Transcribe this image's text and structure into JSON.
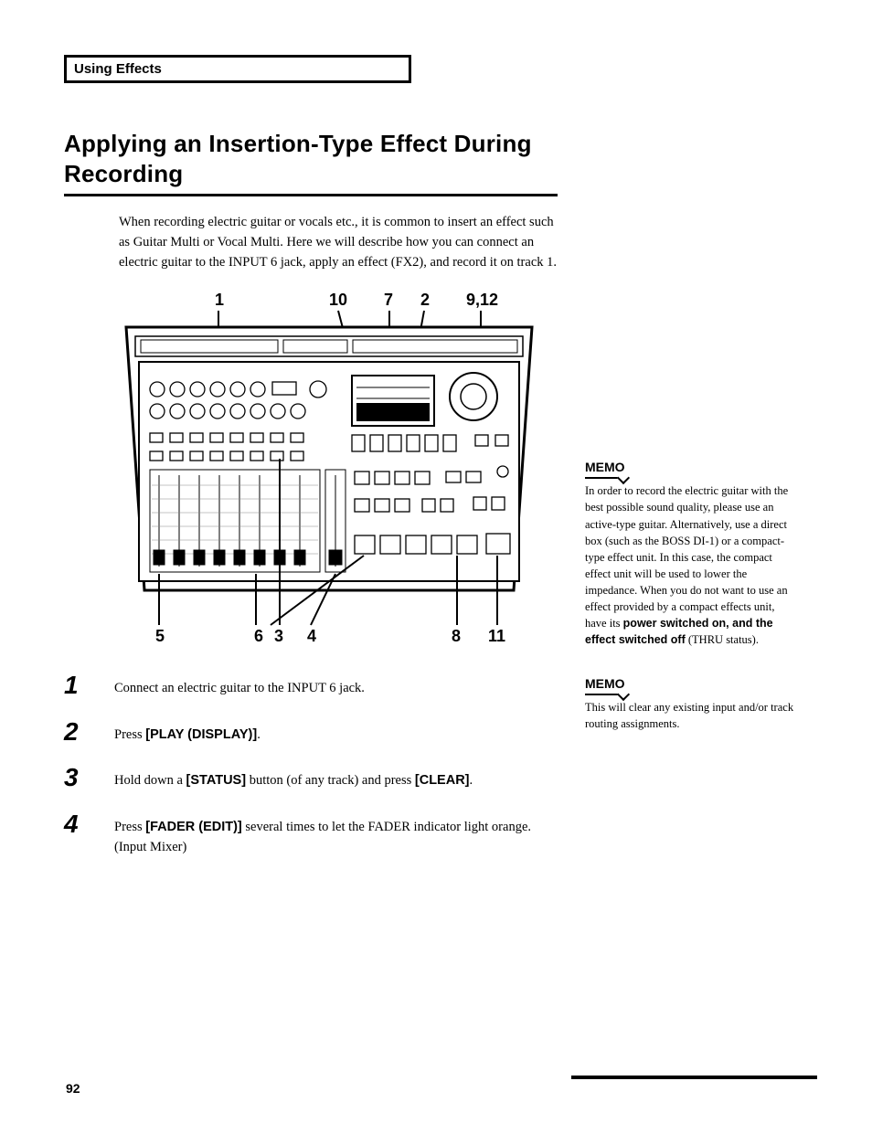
{
  "section_tab": "Using Effects",
  "title": "Applying an Insertion-Type Effect During Recording",
  "intro": "When recording electric guitar or vocals etc., it is common to insert an effect such as Guitar Multi or Vocal Multi. Here we will describe how you can connect an electric guitar to the INPUT 6 jack, apply an effect (FX2), and record it on track 1.",
  "diagram": {
    "top_labels": [
      "1",
      "10",
      "7",
      "2",
      "9,12"
    ],
    "bottom_labels": [
      "5",
      "6",
      "3",
      "4",
      "8",
      "11"
    ]
  },
  "steps": [
    {
      "num": "1",
      "pre": "Connect an electric guitar to the INPUT 6 jack.",
      "bold": "",
      "post": ""
    },
    {
      "num": "2",
      "pre": "Press ",
      "bold": "[PLAY (DISPLAY)]",
      "post": "."
    },
    {
      "num": "3",
      "pre": "Hold down a ",
      "bold": "[STATUS]",
      "post": " button (of any track) and press ",
      "bold2": "[CLEAR]",
      "post2": "."
    },
    {
      "num": "4",
      "pre": "Press ",
      "bold": "[FADER (EDIT)]",
      "post": " several times to let the FADER indicator light orange. (Input Mixer)"
    }
  ],
  "memos": [
    {
      "label": "MEMO",
      "pre": "In order to record the electric guitar with the best possible sound quality, please use an active-type guitar. Alternatively, use a direct box (such as the BOSS DI-1) or a compact-type effect unit. In this case, the compact effect unit will be used to lower the impedance. When you do not want to use an effect provided by a compact effects unit, have its ",
      "bold": "power switched on, and the effect switched off",
      "post": " (THRU status)."
    },
    {
      "label": "MEMO",
      "pre": "This will clear any existing input and/or track routing assignments.",
      "bold": "",
      "post": ""
    }
  ],
  "page_number": "92"
}
